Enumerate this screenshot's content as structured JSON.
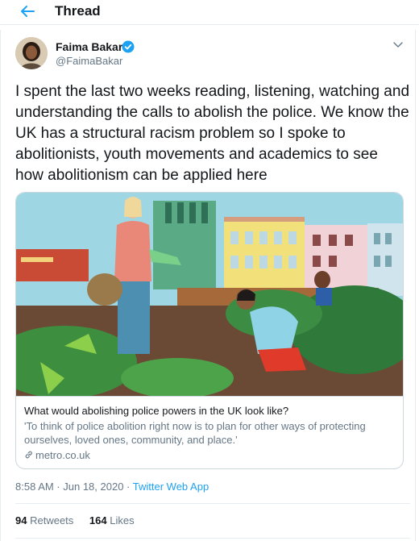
{
  "header": {
    "title": "Thread",
    "back_icon": "arrow-left-icon"
  },
  "tweet": {
    "author_name": "Faima Bakar",
    "author_handle": "@FaimaBakar",
    "text": "I spent the last two weeks reading, listening, watching and understanding the calls to abolish the police. We know the UK has a structural racism problem so I spoke to abolitionists, youth movements and academics to see how abolitionism can be applied here",
    "card": {
      "title": "What would abolishing police powers in the UK look like?",
      "description": "'To think of police abolition right now is to plan for other ways of protecting ourselves, loved ones, community, and place.'",
      "domain": "metro.co.uk"
    },
    "time": "8:58 AM · Jun 18, 2020",
    "separator": " · ",
    "source": "Twitter Web App",
    "retweets": {
      "count": "94",
      "label": "Retweets"
    },
    "likes": {
      "count": "164",
      "label": "Likes"
    }
  },
  "colors": {
    "accent": "#1da1f2",
    "secondary_text": "#657786",
    "border": "#e6ecf0"
  }
}
